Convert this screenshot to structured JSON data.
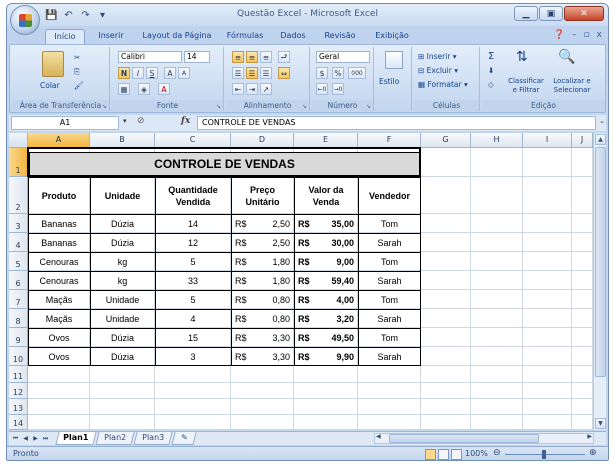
{
  "window": {
    "title": "Questão Excel - Microsoft Excel",
    "controls": {
      "minimize": "▁",
      "restore": "▣",
      "close": "✕"
    }
  },
  "ribbon_tabs": [
    "Início",
    "Inserir",
    "Layout da Página",
    "Fórmulas",
    "Dados",
    "Revisão",
    "Exibição"
  ],
  "active_tab": "Início",
  "ribbon": {
    "clipboard": {
      "label": "Área de Transferência",
      "paste": "Colar"
    },
    "font": {
      "label": "Fonte",
      "name": "Calibri",
      "size": "14",
      "bold": "N",
      "italic": "I",
      "underline": "S"
    },
    "alignment": {
      "label": "Alinhamento"
    },
    "number": {
      "label": "Número",
      "format": "Geral",
      "currency": "$",
      "percent": "%",
      "thousands": "000"
    },
    "styles": {
      "label": "Estilo"
    },
    "cells": {
      "label": "Células",
      "insert": "Inserir",
      "delete": "Excluir",
      "format": "Formatar"
    },
    "editing": {
      "label": "Edição",
      "sum": "Σ",
      "sort_filter": "Classificar e Filtrar",
      "find": "Localizar e Selecionar"
    }
  },
  "formula_bar": {
    "name_box": "A1",
    "fx": "fx",
    "content": "CONTROLE DE VENDAS"
  },
  "columns": [
    "A",
    "B",
    "C",
    "D",
    "E",
    "F",
    "G",
    "H",
    "I",
    "J"
  ],
  "rows": [
    "1",
    "2",
    "3",
    "4",
    "5",
    "6",
    "7",
    "8",
    "9",
    "10",
    "11",
    "12",
    "13",
    "14"
  ],
  "sheet": {
    "title": "CONTROLE DE VENDAS",
    "headers": [
      "Produto",
      "Unidade",
      "Quantidade\nVendida",
      "Preço\nUnitário",
      "Valor da\nVenda",
      "Vendedor"
    ],
    "currency_symbol": "R$",
    "data": [
      {
        "produto": "Bananas",
        "unidade": "Dúzia",
        "qtd": "14",
        "preco": "2,50",
        "valor": "35,00",
        "vendedor": "Tom"
      },
      {
        "produto": "Bananas",
        "unidade": "Dúzia",
        "qtd": "12",
        "preco": "2,50",
        "valor": "30,00",
        "vendedor": "Sarah"
      },
      {
        "produto": "Cenouras",
        "unidade": "kg",
        "qtd": "5",
        "preco": "1,80",
        "valor": "9,00",
        "vendedor": "Tom"
      },
      {
        "produto": "Cenouras",
        "unidade": "kg",
        "qtd": "33",
        "preco": "1,80",
        "valor": "59,40",
        "vendedor": "Sarah"
      },
      {
        "produto": "Maçãs",
        "unidade": "Unidade",
        "qtd": "5",
        "preco": "0,80",
        "valor": "4,00",
        "vendedor": "Tom"
      },
      {
        "produto": "Maçãs",
        "unidade": "Unidade",
        "qtd": "4",
        "preco": "0,80",
        "valor": "3,20",
        "vendedor": "Sarah"
      },
      {
        "produto": "Ovos",
        "unidade": "Dúzia",
        "qtd": "15",
        "preco": "3,30",
        "valor": "49,50",
        "vendedor": "Tom"
      },
      {
        "produto": "Ovos",
        "unidade": "Dúzia",
        "qtd": "3",
        "preco": "3,30",
        "valor": "9,90",
        "vendedor": "Sarah"
      }
    ]
  },
  "sheet_tabs": [
    "Plan1",
    "Plan2",
    "Plan3"
  ],
  "active_sheet": "Plan1",
  "status": {
    "text": "Pronto",
    "zoom": "100%"
  },
  "colors": {
    "accent": "#15428b",
    "selection": "#f2b441",
    "title_fill": "#d9d9d9"
  }
}
